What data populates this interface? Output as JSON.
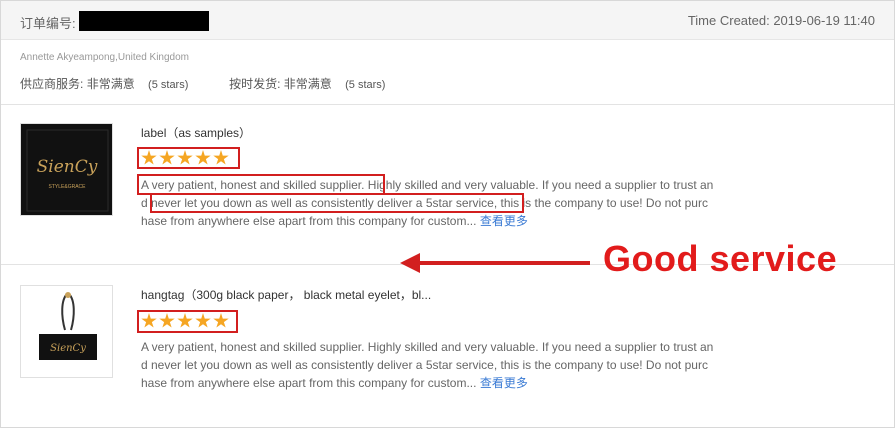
{
  "header": {
    "order_label": "订单编号:",
    "time_created": "Time Created: 2019-06-19 11:40"
  },
  "buyer": "Annette Akyeampong,United Kingdom",
  "ratings": {
    "supplier_service_label": "供应商服务:",
    "supplier_service_value": "非常满意",
    "supplier_service_stars": "(5 stars)",
    "shipping_label": "按时发货:",
    "shipping_value": "非常满意",
    "shipping_stars": "(5 stars)"
  },
  "items": [
    {
      "title": "label（as samples）",
      "stars": 5,
      "review_lines": [
        "A very patient, honest and skilled supplier. Highly skilled and very valuable. If you need a supplier to trust an",
        "d never let you down as well as consistently deliver a 5star service, this is the company to use! Do not purc",
        "hase from anywhere else apart from this company for custom..."
      ],
      "more": "查看更多",
      "thumb_brand": "SienCy",
      "thumb_tagline": "STYLE&GRACE"
    },
    {
      "title": "hangtag（300g black paper， black metal eyelet，bl...",
      "stars": 5,
      "review_lines": [
        "A very patient, honest and skilled supplier. Highly skilled and very valuable. If you need a supplier to trust an",
        "d never let you down as well as consistently deliver a 5star service, this is the company to use! Do not purc",
        "hase from anywhere else apart from this company for custom..."
      ],
      "more": "查看更多",
      "thumb_brand": "SienCy"
    }
  ],
  "annotation": {
    "text": "Good service"
  },
  "colors": {
    "star": "#f5a623",
    "annotation_red": "#d21f1f",
    "link": "#3b7bd4"
  }
}
